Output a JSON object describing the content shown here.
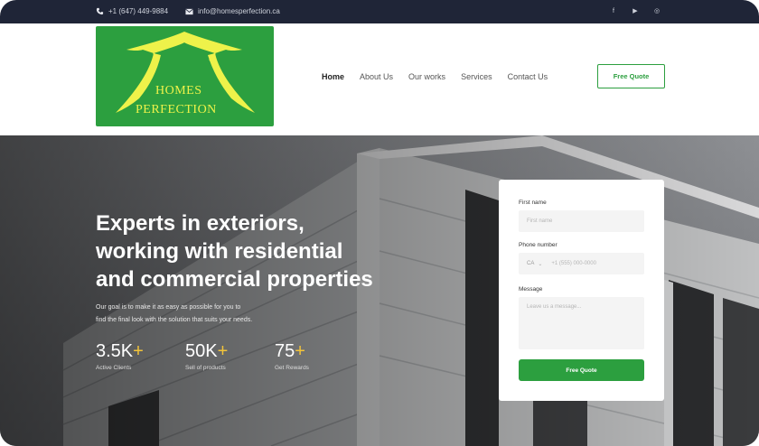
{
  "topbar": {
    "phone": "+1 (647) 449-9884",
    "email": "info@homesperfection.ca",
    "icons": [
      "phone-icon",
      "mail-icon"
    ],
    "social": [
      {
        "name": "facebook-icon",
        "glyph": "f"
      },
      {
        "name": "youtube-icon",
        "glyph": "▶"
      },
      {
        "name": "instagram-icon",
        "glyph": "◎"
      }
    ]
  },
  "logo": {
    "line1": "HOMES",
    "line2": "PERFECTION",
    "bg_color": "#2c9f3f",
    "text_color": "#eef24a"
  },
  "nav": {
    "items": [
      "Home",
      "About Us",
      "Our works",
      "Services",
      "Contact Us"
    ],
    "active": "Home"
  },
  "header_cta": "Free Quote",
  "hero": {
    "title_lines": [
      "Experts in exteriors,",
      "working with residential",
      "and commercial properties"
    ],
    "subtitle_lines": [
      "Our goal is to make it as easy as possible for you to",
      "find the final look with the solution that suits your needs."
    ],
    "stats": [
      {
        "value": "3.5K",
        "plus": "+",
        "label": "Active Clients"
      },
      {
        "value": "50K",
        "plus": "+",
        "label": "Sell of products"
      },
      {
        "value": "75",
        "plus": "+",
        "label": "Get Rewards"
      }
    ]
  },
  "form": {
    "first_name_label": "First name",
    "first_name_placeholder": "First name",
    "phone_label": "Phone number",
    "phone_country": "CA",
    "phone_placeholder": "+1 (555) 000-0000",
    "message_label": "Message",
    "message_placeholder": "Leave us a message...",
    "submit_label": "Free Quote"
  },
  "colors": {
    "brand_green": "#2c9f3f",
    "accent_yellow": "#f3c43a",
    "topbar": "#1f2537"
  }
}
